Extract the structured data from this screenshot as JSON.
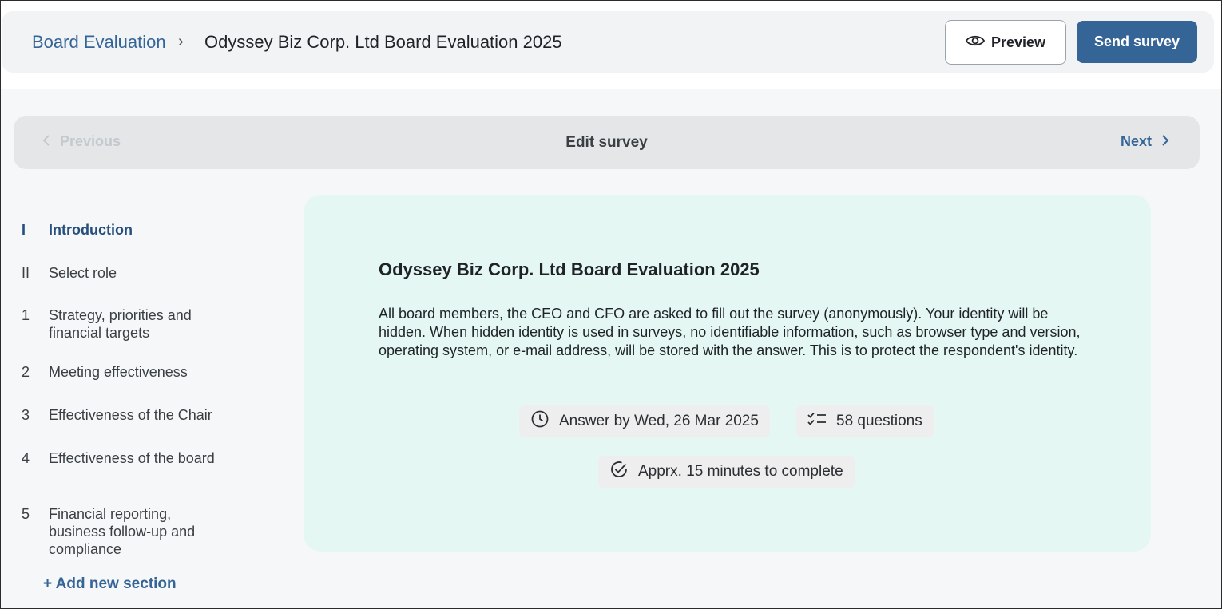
{
  "header": {
    "breadcrumb_root": "Board Evaluation",
    "breadcrumb_separator": "›",
    "breadcrumb_current": "Odyssey Biz Corp. Ltd Board Evaluation 2025",
    "preview_label": "Preview",
    "send_label": "Send survey"
  },
  "step_nav": {
    "previous_label": "Previous",
    "title": "Edit survey",
    "next_label": "Next"
  },
  "sidebar": {
    "sections": [
      {
        "num": "I",
        "label": "Introduction",
        "active": true
      },
      {
        "num": "II",
        "label": "Select role"
      },
      {
        "num": "1",
        "label": "Strategy, priorities and financial targets"
      },
      {
        "num": "2",
        "label": "Meeting effectiveness"
      },
      {
        "num": "3",
        "label": "Effectiveness of the Chair"
      },
      {
        "num": "4",
        "label": "Effectiveness of the board"
      },
      {
        "num": "5",
        "label": "Financial reporting, business follow-up and compliance"
      }
    ],
    "add_section_label": "+ Add new section"
  },
  "intro_card": {
    "title": "Odyssey Biz Corp. Ltd Board Evaluation 2025",
    "body": "All board members, the CEO and CFO are asked to fill out the survey (anonymously). Your identity will be hidden. When hidden identity is used in surveys, no identifiable information, such as browser type and version, operating system, or e-mail address, will be stored with the answer. This is to protect the respondent's identity.",
    "answer_by": "Answer by Wed, 26 Mar 2025",
    "question_count": "58 questions",
    "duration": "Apprx. 15 minutes to complete"
  },
  "colors": {
    "accent": "#356597",
    "card_bg": "#e5f7f2",
    "nav_bg": "#e4e6e8"
  }
}
